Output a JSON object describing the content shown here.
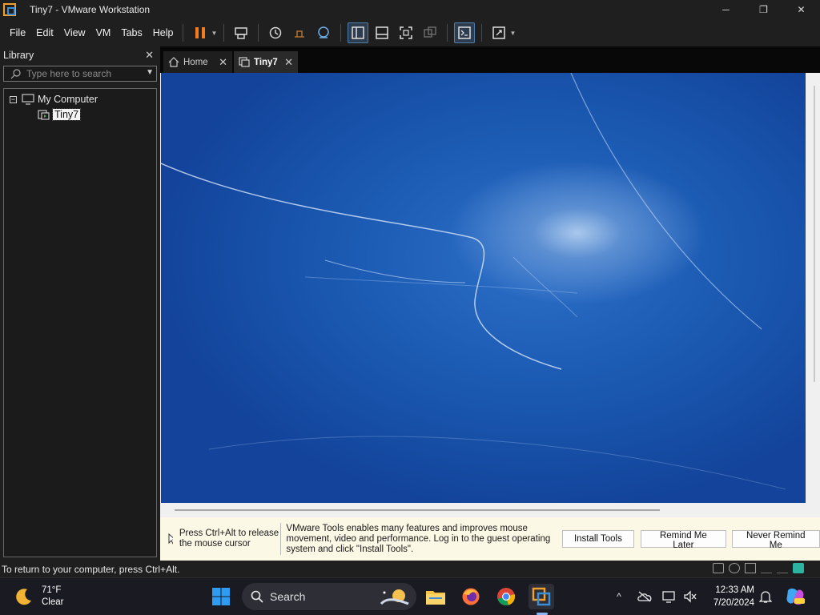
{
  "window": {
    "title": "Tiny7 - VMware Workstation",
    "minimize": "─",
    "maximize": "❐",
    "close": "✕"
  },
  "menu": {
    "items": [
      "File",
      "Edit",
      "View",
      "VM",
      "Tabs",
      "Help"
    ]
  },
  "library": {
    "title": "Library",
    "close": "✕",
    "search_placeholder": "Type here to search",
    "tree": {
      "root": "My Computer",
      "expander": "−",
      "child": "Tiny7"
    }
  },
  "tabs": [
    {
      "label": "Home",
      "close": "✕"
    },
    {
      "label": "Tiny7",
      "close": "✕"
    }
  ],
  "hint": {
    "release_text": "Press Ctrl+Alt to release the mouse cursor",
    "tools_message": "VMware Tools enables many features and improves mouse movement, video and performance. Log in to the guest operating system and click \"Install Tools\".",
    "install_button": "Install Tools",
    "remind_later_button": "Remind Me Later",
    "never_remind_button": "Never Remind Me"
  },
  "statusbar": {
    "text": "To return to your computer, press Ctrl+Alt."
  },
  "taskbar": {
    "weather_temp": "71°F",
    "weather_cond": "Clear",
    "search_placeholder": "Search",
    "time": "12:33 AM",
    "date": "7/20/2024",
    "tray_chevron": "^"
  },
  "colors": {
    "accent": "#f47c20",
    "vm_blue": "#1a58b0",
    "hint_bg": "#fbf8e6"
  }
}
